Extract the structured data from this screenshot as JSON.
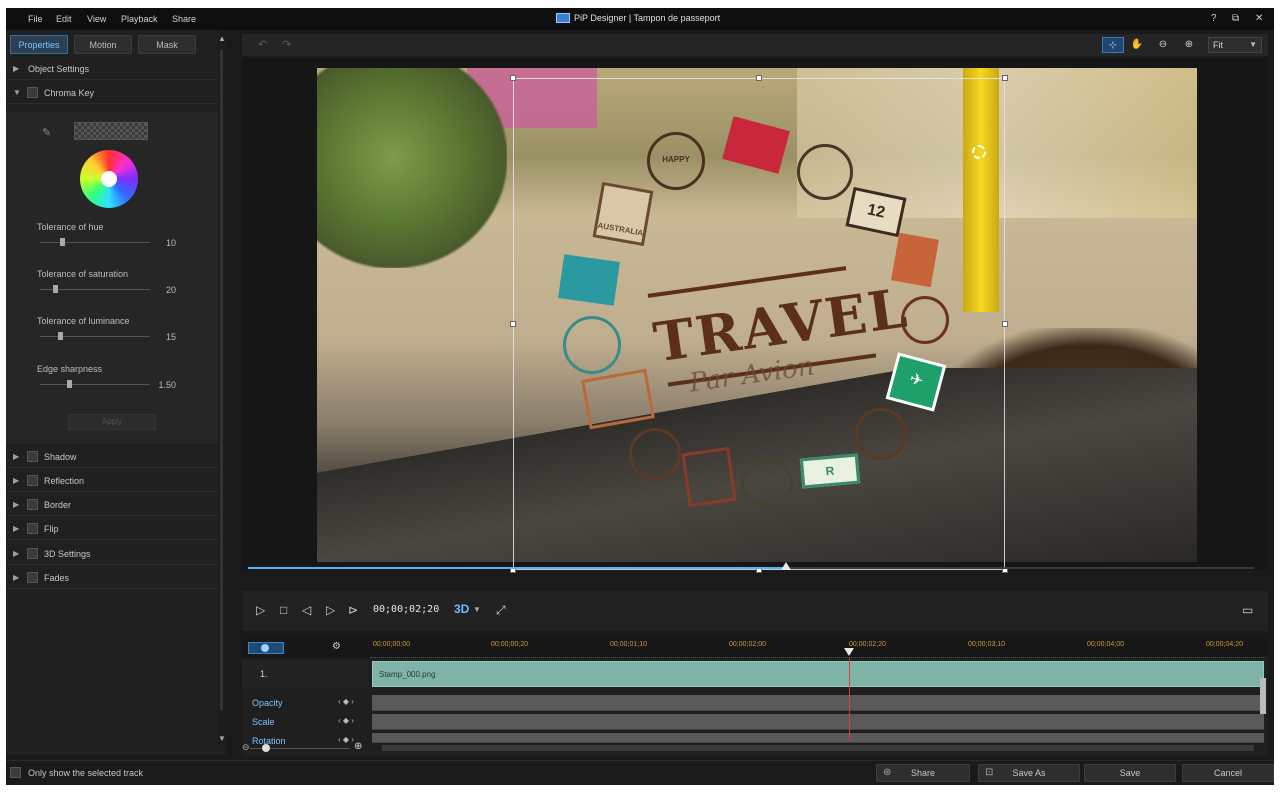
{
  "window": {
    "title": "PiP Designer | Tampon de passeport",
    "menu": [
      "File",
      "Edit",
      "View",
      "Playback",
      "Share"
    ],
    "controls": {
      "help": "?",
      "restore": "⧉",
      "close": "✕"
    }
  },
  "left_panel": {
    "tabs": [
      {
        "label": "Properties",
        "active": true
      },
      {
        "label": "Motion",
        "active": false
      },
      {
        "label": "Mask",
        "active": false
      }
    ],
    "sections": {
      "object_settings": "Object Settings",
      "chroma_key": "Chroma Key",
      "shadow": "Shadow",
      "reflection": "Reflection",
      "border": "Border",
      "flip": "Flip",
      "settings_3d": "3D Settings",
      "fades": "Fades"
    },
    "chroma": {
      "sliders": [
        {
          "label": "Tolerance of hue",
          "value": "10",
          "fraction": 0.2
        },
        {
          "label": "Tolerance of saturation",
          "value": "20",
          "fraction": 0.14
        },
        {
          "label": "Tolerance of luminance",
          "value": "15",
          "fraction": 0.18
        },
        {
          "label": "Edge sharpness",
          "value": "1.50",
          "fraction": 0.26
        }
      ],
      "apply_label": "Apply"
    }
  },
  "toolbar": {
    "zoom_select": "Fit"
  },
  "preview": {
    "text_title": "TRAVEL",
    "text_sub": "Par Avion",
    "stamps": [
      "AUSTRALIA",
      "12",
      "R",
      "✈",
      "HAPPY"
    ]
  },
  "playback": {
    "timecode": "00;00;02;20",
    "speed": "3D",
    "progress_fraction": 0.535
  },
  "timeline": {
    "ticks": [
      "00;00;00;00",
      "00;00;00;20",
      "00;00;01;10",
      "00;00;02;00",
      "00;00;02;20",
      "00;00;03;10",
      "00;00;04;00",
      "00;00;04;20"
    ],
    "playhead_fraction": 0.535,
    "track_label": "1.",
    "clip_name": "Stamp_000.png",
    "rows": [
      "Opacity",
      "Scale",
      "Rotation"
    ]
  },
  "bottom": {
    "only_selected": "Only show the selected track",
    "share": "Share",
    "save_as": "Save As",
    "save": "Save",
    "cancel": "Cancel"
  },
  "colors": {
    "accent": "#4fb4ff",
    "clip": "#7fb3a8",
    "playhead": "#e03a3a",
    "travel_text": "#5c2f1c"
  }
}
